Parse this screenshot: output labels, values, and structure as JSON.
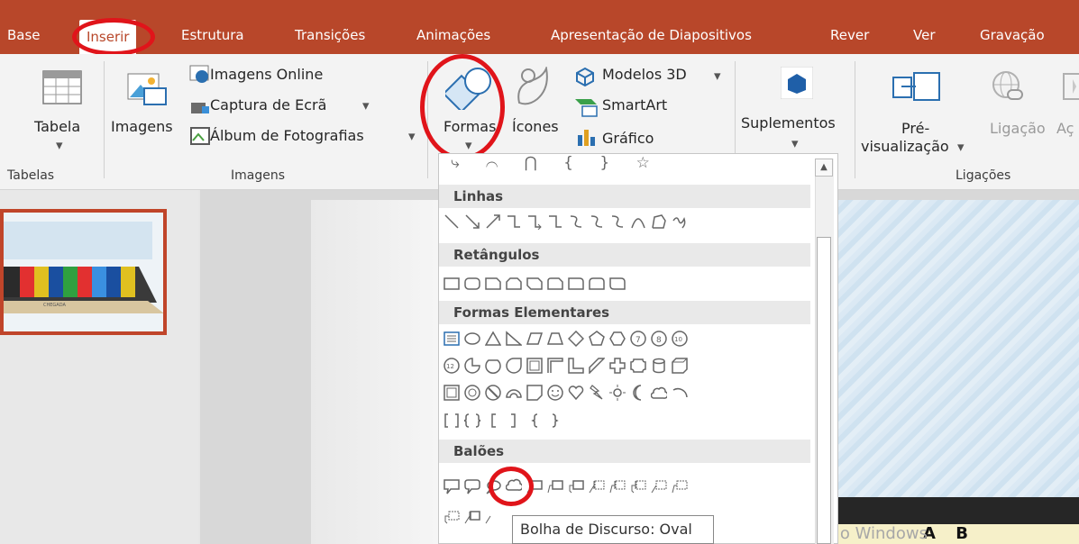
{
  "tabs": [
    "Base",
    "Inserir",
    "Estrutura",
    "Transições",
    "Animações",
    "Apresentação de Diapositivos",
    "Rever",
    "Ver",
    "Gravação"
  ],
  "active_tab": "Inserir",
  "ribbon": {
    "tabela": "Tabela",
    "imagens": "Imagens",
    "imagens_online": "Imagens Online",
    "captura": "Captura de Ecrã",
    "album": "Álbum de Fotografias",
    "formas": "Formas",
    "icones": "Ícones",
    "modelos3d": "Modelos 3D",
    "smartart": "SmartArt",
    "grafico": "Gráfico",
    "suplementos": "Suplementos",
    "pre_line1": "Pré-",
    "pre_line2": "visualização",
    "ligacao": "Ligação",
    "acao": "Aç",
    "groups": {
      "tabelas": "Tabelas",
      "imagens": "Imagens",
      "ligacoes": "Ligações"
    },
    "dropdown_arrow": "▾"
  },
  "shapes_menu": {
    "categories": [
      "Linhas",
      "Retângulos",
      "Formas Elementares",
      "Balões"
    ],
    "top_row_chars": "⤷ ⌒ ⋂ { } ☆"
  },
  "thumbnail": {
    "label": "CHEGADA"
  },
  "tooltip": "Bolha de Discurso: Oval",
  "watermark": "Ativar o Windows",
  "bottom_letters": "A B",
  "colors": {
    "accent": "#b8472a",
    "highlight_ring": "#e0141a"
  }
}
